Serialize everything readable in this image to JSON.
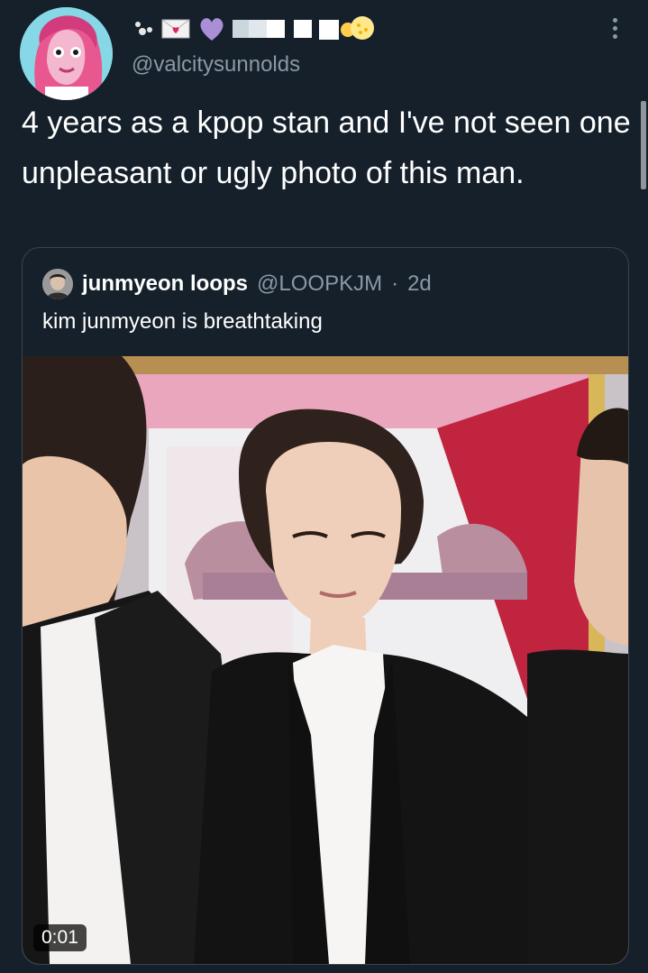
{
  "tweet": {
    "handle": "@valcitysunnolds",
    "display_name_emojis": [
      "bear-icon",
      "love-letter-icon",
      "purple-heart-icon",
      "white-square-icon",
      "white-square-icon",
      "sun-icon"
    ],
    "text": "4 years as a kpop stan and I've not seen one unpleasant or ugly photo of this man."
  },
  "quoted_tweet": {
    "name": "junmyeon loops",
    "handle": "@LOOPKJM",
    "separator": "·",
    "age": "2d",
    "text": "kim junmyeon is breathtaking",
    "video": {
      "timestamp": "0:01"
    }
  },
  "colors": {
    "background": "#15202b",
    "text_primary": "#ffffff",
    "text_secondary": "#8b98a5",
    "border": "#38444d"
  }
}
